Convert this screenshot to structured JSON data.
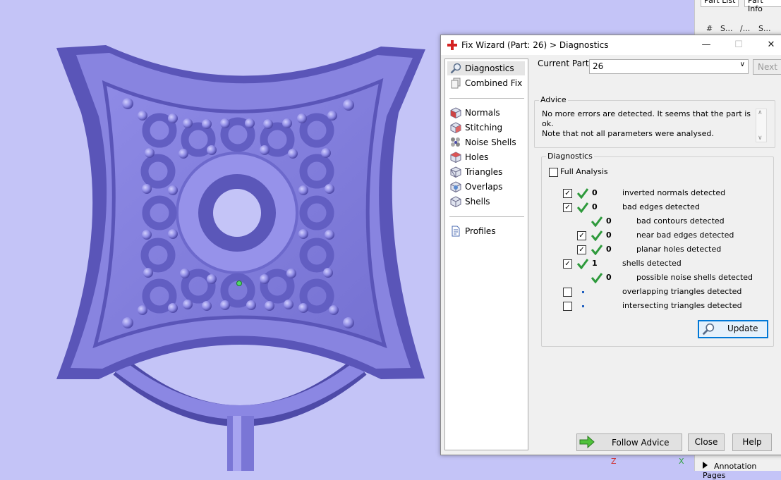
{
  "dialog": {
    "title": "Fix Wizard (Part: 26) > Diagnostics",
    "minimize_icon": "minimize-icon",
    "maximize_icon": "maximize-icon",
    "close_icon": "close-icon"
  },
  "nav": {
    "items": [
      {
        "label": "Diagnostics",
        "icon": "magnifier-icon"
      },
      {
        "label": "Combined Fix",
        "icon": "pages-icon"
      },
      {
        "label": "Normals",
        "icon": "cube-icon"
      },
      {
        "label": "Stitching",
        "icon": "cube-icon"
      },
      {
        "label": "Noise Shells",
        "icon": "dots-icon"
      },
      {
        "label": "Holes",
        "icon": "cube-icon"
      },
      {
        "label": "Triangles",
        "icon": "cube-icon"
      },
      {
        "label": "Overlaps",
        "icon": "cube-icon"
      },
      {
        "label": "Shells",
        "icon": "cube-icon"
      },
      {
        "label": "Profiles",
        "icon": "document-icon"
      }
    ]
  },
  "current_part": {
    "label": "Current Part:",
    "value": "26",
    "next_label": "Next"
  },
  "advice": {
    "title": "Advice",
    "text_line1": "No more errors are detected. It seems that the part is ok.",
    "text_line2": "Note that not all parameters were analysed."
  },
  "diagnostics": {
    "title": "Diagnostics",
    "full_analysis_label": "Full Analysis",
    "rows": [
      {
        "count": "0",
        "label": "inverted normals detected"
      },
      {
        "count": "0",
        "label": "bad edges detected"
      },
      {
        "count": "0",
        "label": "bad contours detected"
      },
      {
        "count": "0",
        "label": "near bad edges detected"
      },
      {
        "count": "0",
        "label": "planar holes detected"
      },
      {
        "count": "1",
        "label": "shells detected"
      },
      {
        "count": "0",
        "label": "possible noise shells detected"
      },
      {
        "count": "",
        "label": "overlapping triangles detected"
      },
      {
        "count": "",
        "label": "intersecting triangles detected"
      }
    ],
    "update_label": "Update"
  },
  "footer": {
    "follow_advice": "Follow Advice",
    "close": "Close",
    "help": "Help"
  },
  "right_panel": {
    "tab1": "Part List",
    "tab2": "Part Info",
    "col_hash": "#",
    "col_s": "S...",
    "col_slash": "/...",
    "col_s2": "S...",
    "annotation": "Annotation Pages"
  },
  "axes": {
    "z": "Z",
    "x": "X"
  },
  "colors": {
    "model": "#7b77d8",
    "background": "#c4c4f7",
    "accent_green": "#2e9a3c"
  }
}
